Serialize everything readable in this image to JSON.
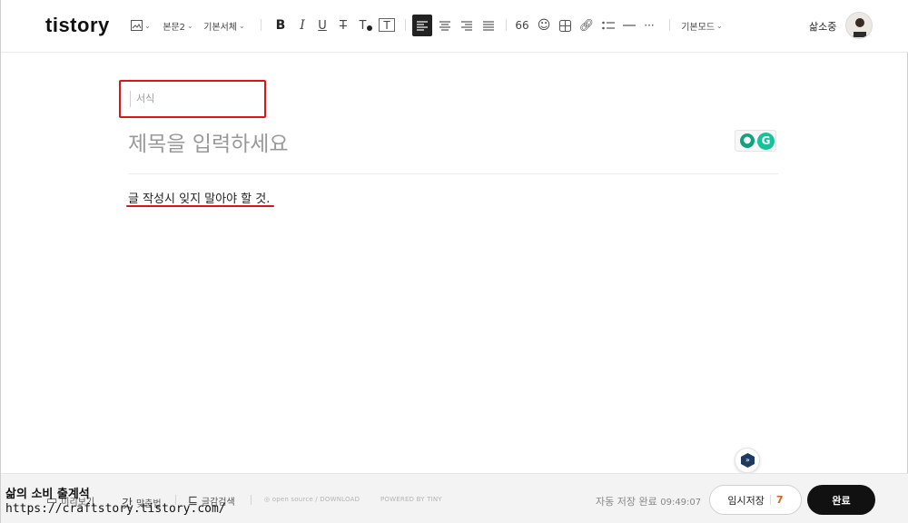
{
  "app": {
    "logo": "tistory"
  },
  "toolbar": {
    "image_icon_caret": "⌄",
    "paragraph_style": "본문2",
    "font_family": "기본서체",
    "bold": "B",
    "italic": "I",
    "underline": "U",
    "strike": "T",
    "text_color": "T",
    "text_bg": "T",
    "quote": "66",
    "more": "···",
    "mode": "기본모드"
  },
  "user": {
    "name": "삶소중"
  },
  "editor": {
    "format_placeholder": "서식",
    "title_placeholder": "제목을 입력하세요",
    "body_text": "글 작성시 잊지 말아야 할 것."
  },
  "bottombar": {
    "preview_label": "미리보기",
    "spellcheck_label": "맞춤법",
    "search_label": "글감검색",
    "open_source": "open source / DOWNLOAD",
    "powered_by": "POWERED BY TINY",
    "autosave_label": "자동 저장 완료",
    "autosave_time": "09:49:07",
    "draft_label": "임시저장",
    "draft_count": "7",
    "done_label": "완료"
  },
  "watermark": {
    "line1": "삶의 소비 출계석",
    "line2": "https://craftstory.tistory.com/"
  },
  "colors": {
    "accent_red": "#d9151b",
    "dark": "#111111",
    "draft_count": "#e65a1e"
  }
}
